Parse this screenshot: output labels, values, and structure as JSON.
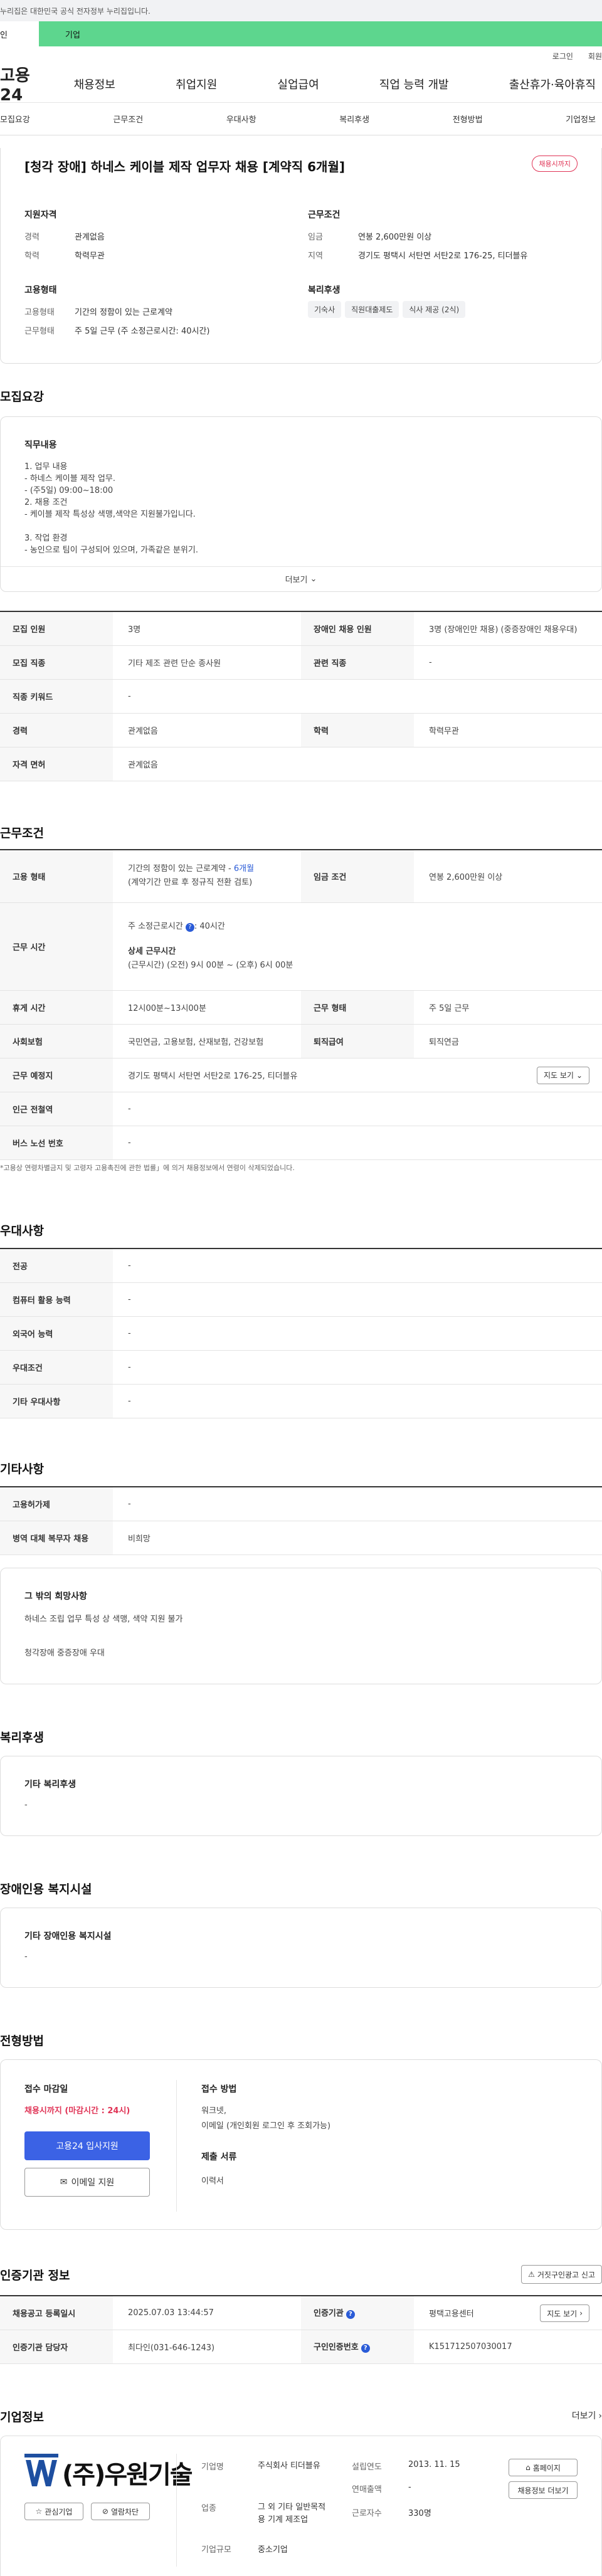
{
  "topbar": {
    "notice": "누리집은 대한민국 공식 전자정부 누리집입니다."
  },
  "greenbar": {
    "tab1": "인",
    "tab2": "기업"
  },
  "util": {
    "login": "로그인",
    "join": "회원"
  },
  "gnb": {
    "logo": "고용24",
    "menu": [
      "채용정보",
      "취업지원",
      "실업급여",
      "직업 능력 개발",
      "출산휴가·육아휴직"
    ]
  },
  "subnav": [
    "모집요강",
    "근무조건",
    "우대사항",
    "복리후생",
    "전형방법",
    "기업정보"
  ],
  "summary": {
    "title": "[청각 장애] 하네스 케이블 제작 업무자 채용 [계약직 6개월]",
    "status_badge": "채용시까지",
    "qual_title": "지원자격",
    "career_label": "경력",
    "career_value": "관계없음",
    "edu_label": "학력",
    "edu_value": "학력무관",
    "cond_title": "근무조건",
    "wage_label": "임금",
    "wage_value": "연봉 2,600만원 이상",
    "region_label": "지역",
    "region_value": "경기도 평택시 서탄면 서탄2로 176-25, 티더블유",
    "emp_title": "고용형태",
    "emptype_label": "고용형태",
    "emptype_value": "기간의 정함이 있는 근로계약",
    "worktype_label": "근무형태",
    "worktype_value": "주 5일 근무 (주 소정근로시간: 40시간)",
    "welfare_title": "복리후생",
    "welfare_tags": [
      "기숙사",
      "직원대출제도",
      "식사 제공 (2식)"
    ]
  },
  "recruit": {
    "section_title": "모집요강",
    "job_title": "직무내용",
    "job_lines": [
      "1. 업무 내용",
      "- 하네스 케이블 제작 업무.",
      "- (주5일) 09:00~18:00",
      "2. 채용 조건",
      "- 케이블 제작 특성상 색맹,색약은 지원불가입니다.",
      "",
      "3. 작업 환경",
      "- 농인으로 팀이 구성되어 있으며, 가족같은 분위기."
    ],
    "more_label": "더보기",
    "rows": [
      {
        "l1": "모집 인원",
        "v1": "3명",
        "l2": "장애인 채용 인원",
        "v2": "3명 (장애인만 채용) (중증장애인 채용우대)"
      },
      {
        "l1": "모집 직종",
        "v1": "기타 제조 관련 단순 종사원",
        "l2": "관련 직종",
        "v2": "-"
      },
      {
        "l1": "직종 키워드",
        "v1": "-"
      },
      {
        "l1": "경력",
        "v1": "관계없음",
        "l2": "학력",
        "v2": "학력무관"
      },
      {
        "l1": "자격 면허",
        "v1": "관계없음"
      }
    ]
  },
  "conditions": {
    "section_title": "근무조건",
    "emp_label": "고용 형태",
    "emp_line1_prefix": "기간의 정함이 있는 근로계약 - ",
    "emp_line1_hl": "6개월",
    "emp_line2": "(계약기간 만료 후 정규직 전환 검토)",
    "wage_label": "임금 조건",
    "wage_value": "연봉 2,600만원 이상",
    "hours_label": "근무 시간",
    "hours_main": "주 소정근로시간",
    "hours_main_val": ": 40시간",
    "hours_detail_title": "상세 근무시간",
    "hours_detail": "(근무시간) (오전) 9시 00분 ~ (오후) 6시 00분",
    "rest_label": "휴게 시간",
    "rest_value": "12시00분~13시00분",
    "form_label": "근무 형태",
    "form_value": "주 5일 근무",
    "ins_label": "사회보험",
    "ins_value": "국민연금, 고용보험, 산재보험, 건강보험",
    "ret_label": "퇴직급여",
    "ret_value": "퇴직연금",
    "place_label": "근무 예정지",
    "place_value": "경기도 평택시 서탄면 서탄2로 176-25, 티더블유",
    "map_button": "지도 보기",
    "subway_label": "인근 전철역",
    "subway_value": "-",
    "bus_label": "버스 노선 번호",
    "bus_value": "-",
    "note": "*고용상 연령차별금지 및 고령자 고용촉진에 관한 법률」에 의거 채용정보에서 연령이 삭제되었습니다."
  },
  "pref": {
    "section_title": "우대사항",
    "rows": [
      [
        "전공",
        "-"
      ],
      [
        "컴퓨터 활용 능력",
        "-"
      ],
      [
        "외국어 능력",
        "-"
      ],
      [
        "우대조건",
        "-"
      ],
      [
        "기타 우대사항",
        "-"
      ]
    ]
  },
  "etc": {
    "section_title": "기타사항",
    "rows": [
      [
        "고용허가제",
        "-"
      ],
      [
        "병역 대체 복무자 채용",
        "비희망"
      ]
    ],
    "hope_title": "그 밖의 희망사항",
    "hope_line1": "하네스 조립 업무 특성 상 색맹, 색약 지원 불가",
    "hope_line2": "청각장애 중증장애 우대"
  },
  "welfare": {
    "section_title": "복리후생",
    "box_title": "기타 복리후생",
    "box_value": "-"
  },
  "disab": {
    "section_title": "장애인용 복지시설",
    "box_title": "기타 장애인용 복지시설",
    "box_value": "-"
  },
  "apply": {
    "section_title": "전형방법",
    "deadline_title": "접수 마감일",
    "deadline_value": "채용시까지 (마감시간 : 24시)",
    "apply_button": "고용24 입사지원",
    "email_button": "이메일 지원",
    "method_title": "접수 방법",
    "method_line1": "워크넷,",
    "method_line2": "이메일 (개인회원 로그인 후 조회가능)",
    "docs_title": "제출 서류",
    "docs_value": "이력서"
  },
  "cert": {
    "section_title": "인증기관 정보",
    "report_button": "거짓구인광고 신고",
    "reg_label": "채용공고 등록일시",
    "reg_value": "2025.07.03 13:44:57",
    "org_label": "인증기관",
    "org_value": "평택고용센터",
    "map_button": "지도 보기",
    "mgr_label": "인증기관 담당자",
    "mgr_value": "최다인(031-646-1243)",
    "no_label": "구인인증번호",
    "no_value": "K151712507030017"
  },
  "company": {
    "section_title": "기업정보",
    "more": "더보기",
    "logo_text": "(주)우원기술",
    "interest_button": "관심기업",
    "block_button": "열람차단",
    "name_label": "기업명",
    "name_value": "주식회사 티더블유",
    "year_label": "설립연도",
    "year_value": "2013. 11. 15",
    "sales_label": "연매출액",
    "sales_value": "-",
    "biz_label": "업종",
    "biz_value": "그 외 기타 일반목적용 기계 제조업",
    "emp_label": "근로자수",
    "emp_value": "330명",
    "size_label": "기업규모",
    "size_value": "중소기업",
    "home_button": "홈페이지",
    "jobs_button": "채용정보 더보기"
  },
  "colors": {
    "green": "#5dd68e",
    "blue": "#2a5bd7",
    "red": "#e03456"
  }
}
